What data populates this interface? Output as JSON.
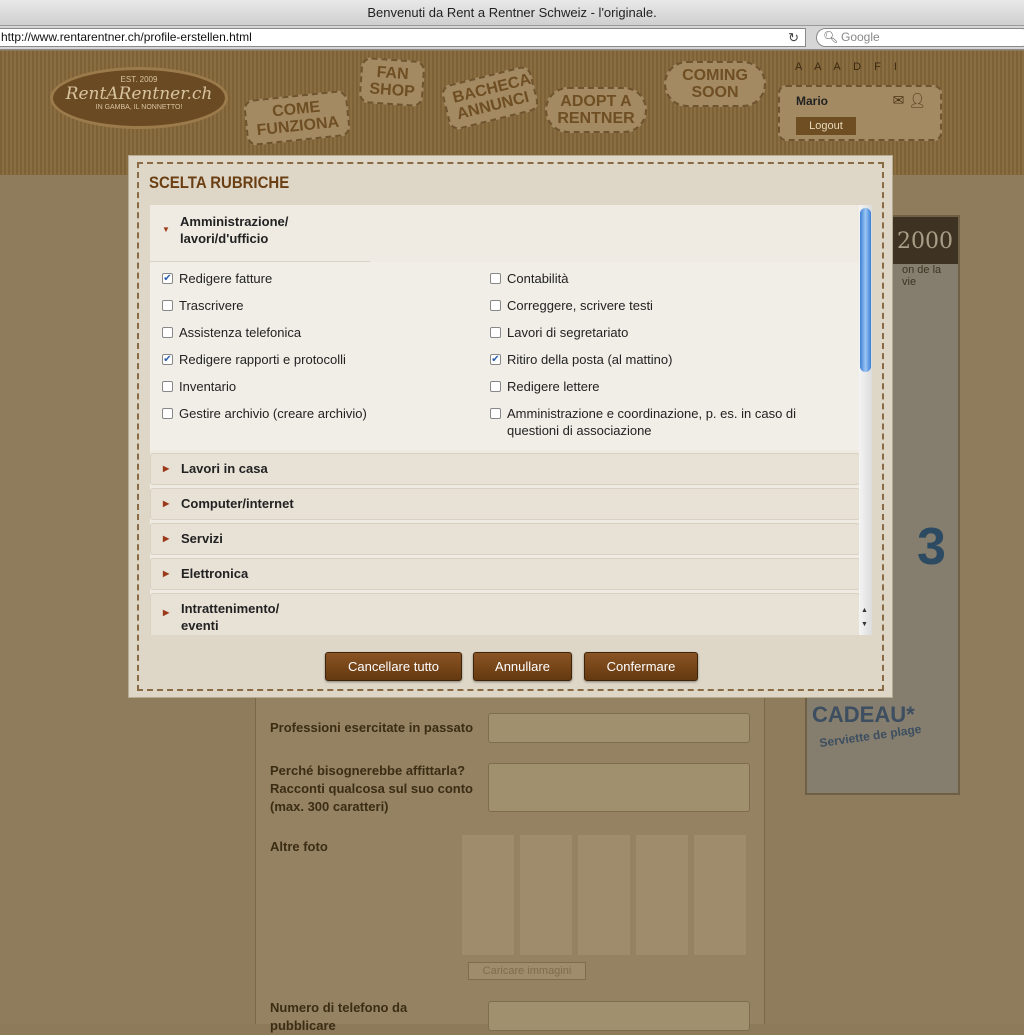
{
  "browser": {
    "title": "Benvenuti da Rent a Rentner Schweiz - l'originale.",
    "url": "http://www.rentarentner.ch/profile-erstellen.html",
    "search_placeholder": "Google"
  },
  "header": {
    "logo": {
      "est": "EST. 2009",
      "name": "RentARentner.ch",
      "tagline": "IN GAMBA, IL NONNETTO!"
    },
    "nav": [
      "COME FUNZIONA",
      "FAN SHOP",
      "BACHECA ANNUNCI",
      "ADOPT A RENTNER",
      "COMING SOON"
    ],
    "languages": "A A A D F I",
    "user": "Mario",
    "logout": "Logout"
  },
  "form": {
    "past_jobs_label": "Professioni esercitate in passato",
    "why_label": "Perché bisognerebbe affittarla? Racconti qualcosa sul suo conto (max. 300 caratteri)",
    "photos_label": "Altre foto",
    "upload_label": "Caricare immagini",
    "phone_label": "Numero di telefono da pubblicare"
  },
  "ad": {
    "brand": "2000",
    "line": "on de la vie",
    "big": "3",
    "cadeau": "CADEAU*",
    "sub": "Serviette de plage"
  },
  "modal": {
    "title": "SCELTA RUBRICHE",
    "open_section": {
      "label": "Amministrazione/ lavori/d'ufficio",
      "items": [
        {
          "label": "Redigere fatture",
          "checked": true
        },
        {
          "label": "Contabilità",
          "checked": false
        },
        {
          "label": "Trascrivere",
          "checked": false
        },
        {
          "label": "Correggere, scrivere testi",
          "checked": false
        },
        {
          "label": "Assistenza telefonica",
          "checked": false
        },
        {
          "label": "Lavori di segretariato",
          "checked": false
        },
        {
          "label": "Redigere rapporti e protocolli",
          "checked": true
        },
        {
          "label": "Ritiro della posta (al mattino)",
          "checked": true
        },
        {
          "label": "Inventario",
          "checked": false
        },
        {
          "label": "Redigere lettere",
          "checked": false
        },
        {
          "label": "Gestire archivio (creare archivio)",
          "checked": false
        },
        {
          "label": "Amministrazione e coordinazione, p. es. in caso di questioni di associazione",
          "checked": false
        }
      ]
    },
    "sections": [
      "Lavori in casa",
      "Computer/internet",
      "Servizi",
      "Elettronica",
      "Intrattenimento/ eventi"
    ],
    "buttons": {
      "clear": "Cancellare tutto",
      "cancel": "Annullare",
      "confirm": "Confermare"
    }
  }
}
